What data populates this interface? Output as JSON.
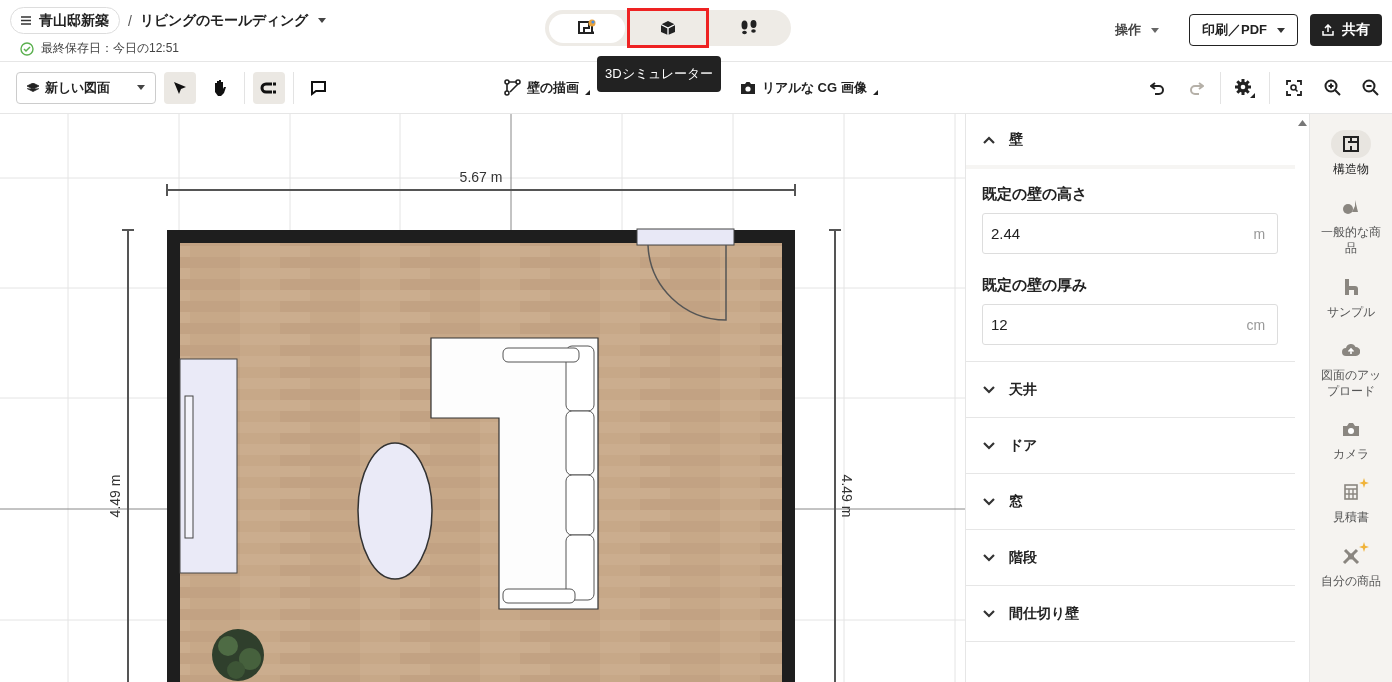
{
  "project": {
    "name": "青山邸新築"
  },
  "breadcrumb_separator": "/",
  "plan_title": "リビングのモールディング",
  "save_status": "最終保存日：今日の12:51",
  "view_tabs": [
    {
      "kind": "plan",
      "selected": true,
      "highlighted": false
    },
    {
      "kind": "cube",
      "selected": false,
      "highlighted": true
    },
    {
      "kind": "walk",
      "selected": false,
      "highlighted": false
    }
  ],
  "tooltip": "3Dシミュレーター",
  "actions_menu": "操作",
  "print_button": "印刷／PDF",
  "share_button": "共有",
  "layer_select": "新しい図面",
  "tools": [
    {
      "kind": "select",
      "selected": true
    },
    {
      "kind": "pan",
      "selected": false
    },
    {
      "kind": "magnet",
      "selected": true
    },
    {
      "kind": "comment",
      "selected": false
    }
  ],
  "center_tools": [
    {
      "kind": "wall",
      "label": "壁の描画"
    },
    {
      "kind": "camera",
      "label": "リアルな CG 画像"
    }
  ],
  "history": [
    {
      "kind": "undo",
      "disabled": false
    },
    {
      "kind": "redo",
      "disabled": true
    }
  ],
  "canvas": {
    "width_label": "5.67 m",
    "left_height_label": "4.49 m",
    "right_height_label": "4.49 m"
  },
  "sections": [
    {
      "title": "壁",
      "expanded": true,
      "fields": [
        {
          "label": "既定の壁の高さ",
          "value": "2.44",
          "unit": "m"
        },
        {
          "label": "既定の壁の厚み",
          "value": "12",
          "unit": "cm"
        }
      ]
    },
    {
      "title": "天井",
      "expanded": false
    },
    {
      "title": "ドア",
      "expanded": false
    },
    {
      "title": "窓",
      "expanded": false
    },
    {
      "title": "階段",
      "expanded": false
    },
    {
      "title": "間仕切り壁",
      "expanded": false
    }
  ],
  "rail": [
    {
      "kind": "structure",
      "label": "構造物",
      "selected": true,
      "new": false
    },
    {
      "kind": "items",
      "label": "一般的な商品",
      "selected": false,
      "new": false
    },
    {
      "kind": "sample",
      "label": "サンプル",
      "selected": false,
      "new": false
    },
    {
      "kind": "upload",
      "label": "図面のアップロード",
      "selected": false,
      "new": false
    },
    {
      "kind": "camera",
      "label": "カメラ",
      "selected": false,
      "new": false
    },
    {
      "kind": "estimate",
      "label": "見積書",
      "selected": false,
      "new": true
    },
    {
      "kind": "mine",
      "label": "自分の商品",
      "selected": false,
      "new": true
    }
  ]
}
